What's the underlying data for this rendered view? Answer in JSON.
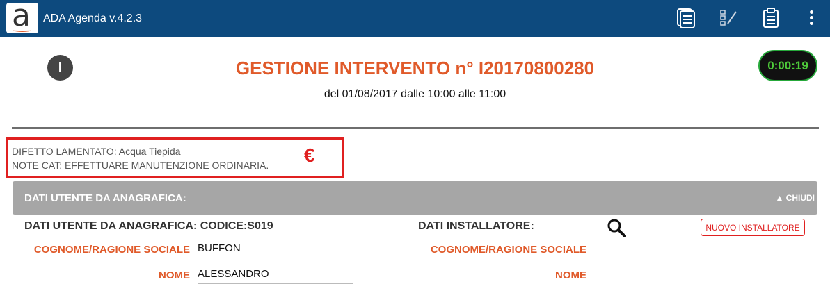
{
  "appbar": {
    "title": "ADA Agenda v.4.2.3",
    "logo_letter": "a",
    "icons": [
      "documents-icon",
      "edit-list-icon",
      "clipboard-icon",
      "more-vert-icon"
    ]
  },
  "header": {
    "info_label": "I",
    "title": "GESTIONE INTERVENTO n° I20170800280",
    "subtitle": "del 01/08/2017 dalle 10:00 alle 11:00",
    "timer": "0:00:19"
  },
  "notes": {
    "difetto": "DIFETTO LAMENTATO: Acqua Tiepida",
    "note_cat": "NOTE CAT: EFFETTUARE MANUTENZIONE ORDINARIA.",
    "euro_symbol": "€"
  },
  "section": {
    "title": "DATI UTENTE DA ANAGRAFICA:",
    "close_label": "CHIUDI"
  },
  "user": {
    "heading": "DATI UTENTE DA ANAGRAFICA:  CODICE:S019",
    "cognome_label": "COGNOME/RAGIONE SOCIALE",
    "cognome_value": "BUFFON",
    "nome_label": "NOME",
    "nome_value": "ALESSANDRO"
  },
  "installer": {
    "heading": "DATI INSTALLATORE:",
    "new_button": "NUOVO INSTALLATORE",
    "cognome_label": "COGNOME/RAGIONE SOCIALE",
    "cognome_value": "",
    "nome_label": "NOME"
  },
  "colors": {
    "appbar": "#0d4a7e",
    "accent": "#e05a2a",
    "alert": "#e02020",
    "timer_text": "#4ecb3a"
  }
}
